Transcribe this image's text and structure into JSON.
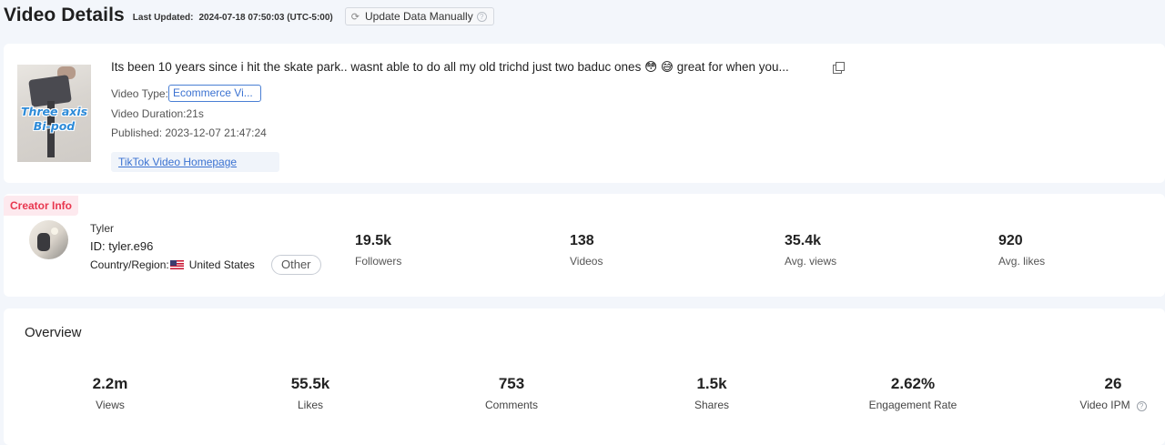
{
  "header": {
    "title": "Video Details",
    "last_updated_label": "Last Updated:",
    "last_updated_value": "2024-07-18 07:50:03 (UTC-5:00)",
    "update_button": "Update Data Manually"
  },
  "video": {
    "description": "Its been 10 years since i hit the skate park.. wasnt able to do all my old trichd just two baduc ones 😳 😅 great for when you...",
    "thumbnail_text_line1": "Three axis",
    "thumbnail_text_line2": "Bi-pod",
    "type_label": "Video Type:",
    "type_value": "Ecommerce Vi...",
    "duration": "Video Duration:21s",
    "published": "Published: 2023-12-07 21:47:24",
    "homepage_link": "TikTok Video Homepage"
  },
  "creator": {
    "tag": "Creator Info",
    "name": "Tyler",
    "id": "ID: tyler.e96",
    "country_label": "Country/Region:",
    "country_value": "United States",
    "category": "Other",
    "stats": [
      {
        "value": "19.5k",
        "label": "Followers"
      },
      {
        "value": "138",
        "label": "Videos"
      },
      {
        "value": "35.4k",
        "label": "Avg. views"
      },
      {
        "value": "920",
        "label": "Avg. likes"
      }
    ]
  },
  "overview": {
    "title": "Overview",
    "stats": [
      {
        "value": "2.2m",
        "label": "Views"
      },
      {
        "value": "55.5k",
        "label": "Likes"
      },
      {
        "value": "753",
        "label": "Comments"
      },
      {
        "value": "1.5k",
        "label": "Shares"
      },
      {
        "value": "2.62%",
        "label": "Engagement Rate"
      },
      {
        "value": "26",
        "label": "Video IPM"
      }
    ]
  },
  "colors": {
    "accent_blue": "#3b72d1",
    "creator_tag_red": "#e8374f",
    "background": "#f3f6fb"
  }
}
